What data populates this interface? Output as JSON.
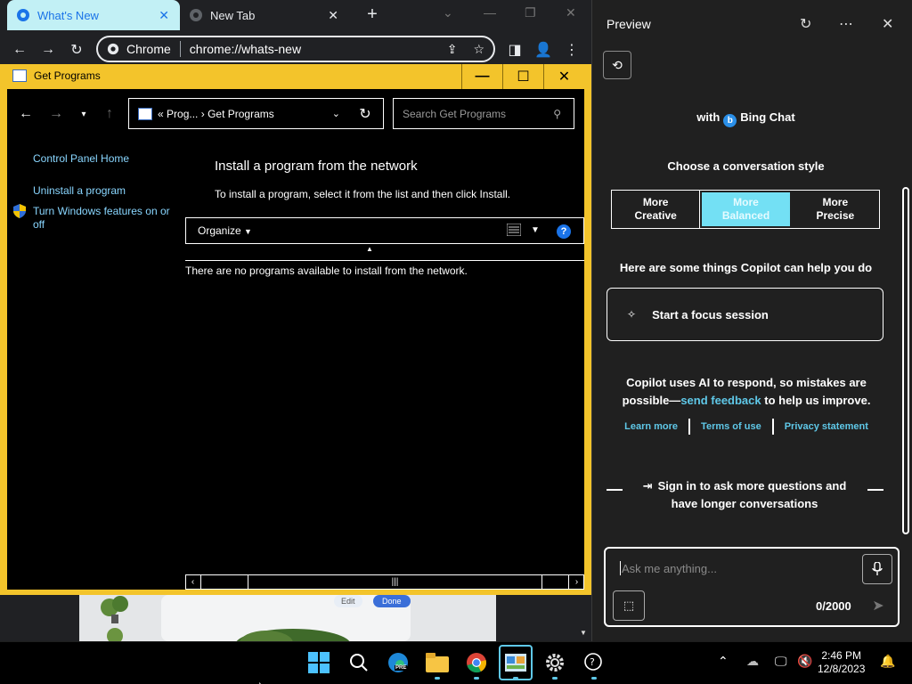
{
  "browser": {
    "tabs": [
      {
        "label": "What's New",
        "active": true
      },
      {
        "label": "New Tab",
        "active": false
      }
    ],
    "omnibox": {
      "site_label": "Chrome",
      "url": "chrome://whats-new"
    }
  },
  "get_programs": {
    "window_title": "Get Programs",
    "breadcrumb_prefix": "«",
    "breadcrumb_parent": "Prog...",
    "breadcrumb_sep": "›",
    "breadcrumb_current": "Get Programs",
    "search_placeholder": "Search Get Programs",
    "sidebar": {
      "home": "Control Panel Home",
      "uninstall": "Uninstall a program",
      "features": "Turn Windows features on or off"
    },
    "heading": "Install a program from the network",
    "description": "To install a program, select it from the list and then click Install.",
    "organize": "Organize",
    "help": "?",
    "empty_message": "There are no programs available to install from the network."
  },
  "page_behind": {
    "edit": "Edit",
    "done": "Done"
  },
  "copilot": {
    "title": "Preview",
    "with_prefix": "with",
    "bing_chat": "Bing Chat",
    "choose_style": "Choose a conversation style",
    "styles": [
      {
        "line1": "More",
        "line2": "Creative",
        "active": false
      },
      {
        "line1": "More",
        "line2": "Balanced",
        "active": true
      },
      {
        "line1": "More",
        "line2": "Precise",
        "active": false
      }
    ],
    "help_heading": "Here are some things Copilot can help you do",
    "suggestion": "Start a focus session",
    "disclaimer_pre": "Copilot uses AI to respond, so mistakes are possible—",
    "disclaimer_link": "send feedback",
    "disclaimer_post": " to help us improve.",
    "links": [
      "Learn more",
      "Terms of use",
      "Privacy statement"
    ],
    "signin": "Sign in to ask more questions and have longer conversations",
    "input_placeholder": "Ask me anything...",
    "char_count": "0/2000",
    "accent": "#73e0f4"
  },
  "taskbar": {
    "time": "2:46 PM",
    "date": "12/8/2023",
    "edge_badge": "PRE"
  }
}
